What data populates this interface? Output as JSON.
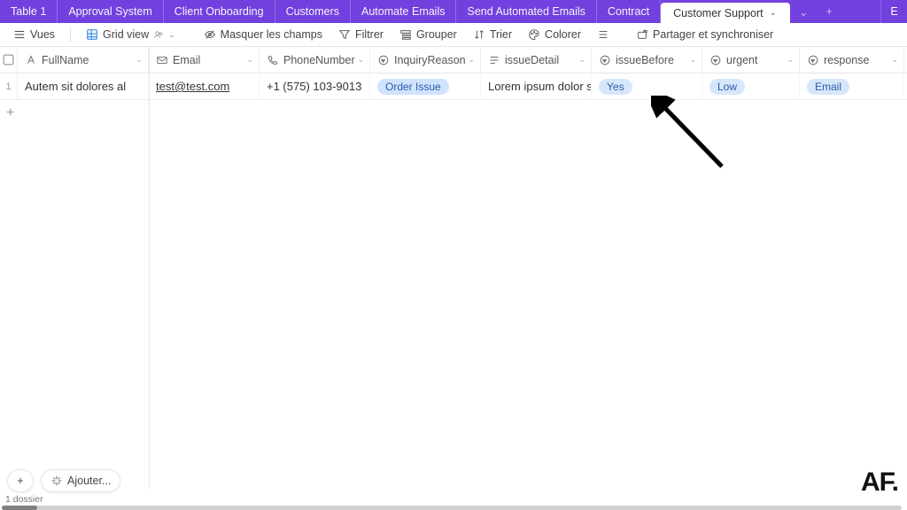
{
  "tabs": [
    {
      "label": "Table 1",
      "active": false
    },
    {
      "label": "Approval System",
      "active": false
    },
    {
      "label": "Client Onboarding",
      "active": false
    },
    {
      "label": "Customers",
      "active": false
    },
    {
      "label": "Automate Emails",
      "active": false
    },
    {
      "label": "Send Automated Emails",
      "active": false
    },
    {
      "label": "Contract",
      "active": false
    },
    {
      "label": "Customer Support",
      "active": true
    }
  ],
  "toolbar": {
    "views": "Vues",
    "gridview": "Grid view",
    "hide": "Masquer les champs",
    "filter": "Filtrer",
    "group": "Grouper",
    "sort": "Trier",
    "color": "Colorer",
    "share": "Partager et synchroniser"
  },
  "columns": {
    "fullname": "FullName",
    "email": "Email",
    "phone": "PhoneNumber",
    "inquiry": "InquiryReason",
    "detail": "issueDetail",
    "before": "issueBefore",
    "urgent": "urgent",
    "response": "response"
  },
  "row1": {
    "num": "1",
    "fullname": "Autem sit dolores al",
    "email": "test@test.com",
    "phone": "+1 (575) 103-9013",
    "inquiry": "Order Issue",
    "detail": "Lorem ipsum dolor sit am…",
    "before": "Yes",
    "urgent": "Low",
    "response": "Email"
  },
  "footer": {
    "add": "Ajouter...",
    "status": "1 dossier"
  },
  "watermark": "AF.",
  "icons": {
    "plus": "+"
  }
}
